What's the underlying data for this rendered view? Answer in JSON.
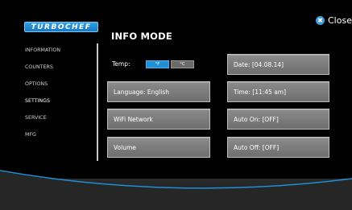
{
  "logo": {
    "text": "TURBOCHEF"
  },
  "header": {
    "title": "INFO MODE",
    "close_label": "Close",
    "close_glyph": "✖"
  },
  "sidebar": {
    "items": [
      {
        "label": "INFORMATION",
        "active": false
      },
      {
        "label": "COUNTERS",
        "active": false
      },
      {
        "label": "OPTIONS",
        "active": false
      },
      {
        "label": "SETTINGS",
        "active": true
      },
      {
        "label": "SERVICE",
        "active": false
      },
      {
        "label": "MFG",
        "active": false
      }
    ]
  },
  "temp": {
    "label": "Temp:",
    "options": [
      "°F",
      "°C"
    ],
    "selected": "°F"
  },
  "buttons": {
    "left": [
      "Language: English",
      "WiFi Network",
      "Volume"
    ],
    "right": [
      "Date: [04.08.14]",
      "Time: [11:45 am]",
      "Auto On: [OFF]",
      "Auto Off: [OFF]"
    ]
  },
  "colors": {
    "accent": "#1f8fd8",
    "button_gray": "#7d7d7d",
    "background": "#000000"
  }
}
